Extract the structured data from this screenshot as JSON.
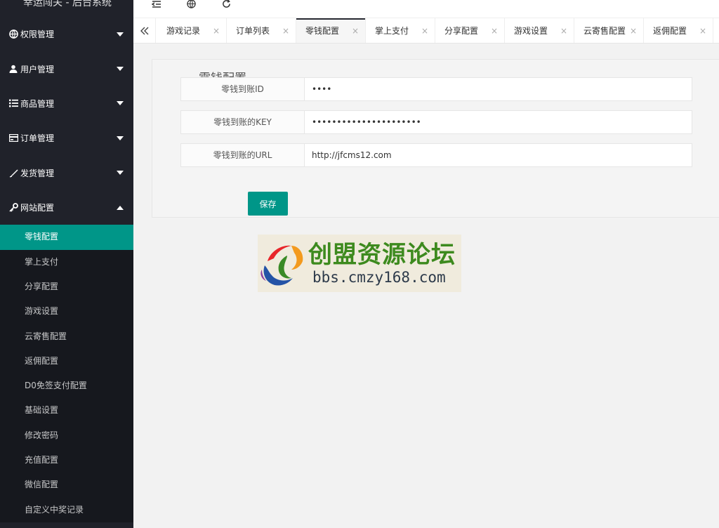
{
  "app": {
    "title": "幸运闯关 - 后台系统"
  },
  "sidebar": {
    "groups": [
      {
        "label": "权限管理",
        "icon": "globe-icon",
        "expanded": false
      },
      {
        "label": "用户管理",
        "icon": "user-icon",
        "expanded": false
      },
      {
        "label": "商品管理",
        "icon": "list-icon",
        "expanded": false
      },
      {
        "label": "订单管理",
        "icon": "card-icon",
        "expanded": false
      },
      {
        "label": "发货管理",
        "icon": "feather-icon",
        "expanded": false
      },
      {
        "label": "网站配置",
        "icon": "key-icon",
        "expanded": true
      }
    ],
    "submenu": [
      {
        "label": "零钱配置",
        "active": true
      },
      {
        "label": "掌上支付"
      },
      {
        "label": "分享配置"
      },
      {
        "label": "游戏设置"
      },
      {
        "label": "云寄售配置"
      },
      {
        "label": "返佣配置"
      },
      {
        "label": "D0免签支付配置"
      },
      {
        "label": "基础设置"
      },
      {
        "label": "修改密码"
      },
      {
        "label": "充值配置"
      },
      {
        "label": "微信配置"
      },
      {
        "label": "自定义中奖记录"
      }
    ]
  },
  "header": {
    "icons": [
      "menu-indent-icon",
      "globe-icon",
      "refresh-icon"
    ]
  },
  "tabs": [
    {
      "label": "游戏记录"
    },
    {
      "label": "订单列表"
    },
    {
      "label": "零钱配置",
      "active": true
    },
    {
      "label": "掌上支付"
    },
    {
      "label": "分享配置"
    },
    {
      "label": "游戏设置"
    },
    {
      "label": "云寄售配置"
    },
    {
      "label": "返佣配置"
    }
  ],
  "tab_close_glyph": "×",
  "form": {
    "legend": "零钱配置",
    "fields": [
      {
        "label": "零钱到账ID",
        "value": "••••"
      },
      {
        "label": "零钱到账的KEY",
        "value": "••••••••••••••••••••••"
      },
      {
        "label": "零钱到账的URL",
        "value": "http://jfcms12.com"
      }
    ],
    "save_label": "保存"
  },
  "watermark": {
    "cn": "创盟资源论坛",
    "en": "bbs.cmzy168.com"
  },
  "colors": {
    "sidebar_bg": "#20222a",
    "accent": "#009688",
    "content_bg": "#f2f2f2"
  }
}
